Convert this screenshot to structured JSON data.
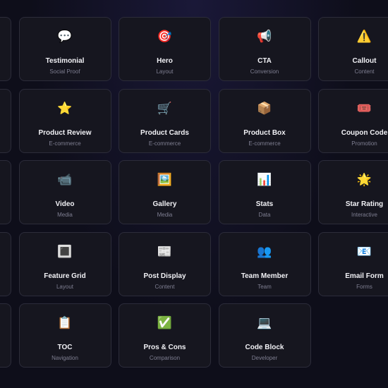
{
  "blocks": [
    {
      "icon": "",
      "name": "",
      "category": ""
    },
    {
      "icon": "💬",
      "icon_name": "speech-bubble-icon",
      "name": "Testimonial",
      "category": "Social Proof"
    },
    {
      "icon": "🎯",
      "icon_name": "target-icon",
      "name": "Hero",
      "category": "Layout"
    },
    {
      "icon": "📢",
      "icon_name": "megaphone-icon",
      "name": "CTA",
      "category": "Conversion"
    },
    {
      "icon": "⚠️",
      "icon_name": "warning-icon",
      "name": "Callout",
      "category": "Content"
    },
    {
      "icon": "",
      "name": "",
      "category": ""
    },
    {
      "icon": "⭐",
      "icon_name": "star-icon",
      "name": "Product Review",
      "category": "E-commerce"
    },
    {
      "icon": "🛒",
      "icon_name": "cart-icon",
      "name": "Product Cards",
      "category": "E-commerce"
    },
    {
      "icon": "📦",
      "icon_name": "package-icon",
      "name": "Product Box",
      "category": "E-commerce"
    },
    {
      "icon": "🎟️",
      "icon_name": "ticket-icon",
      "name": "Coupon Code",
      "category": "Promotion"
    },
    {
      "icon": "",
      "name": "",
      "category": ""
    },
    {
      "icon": "📹",
      "icon_name": "video-camera-icon",
      "name": "Video",
      "category": "Media"
    },
    {
      "icon": "🖼️",
      "icon_name": "framed-picture-icon",
      "name": "Gallery",
      "category": "Media"
    },
    {
      "icon": "📊",
      "icon_name": "bar-chart-icon",
      "name": "Stats",
      "category": "Data"
    },
    {
      "icon": "🌟",
      "icon_name": "glowing-star-icon",
      "name": "Star Rating",
      "category": "Interactive"
    },
    {
      "icon": "",
      "name": "",
      "category": ""
    },
    {
      "icon": "🔳",
      "icon_name": "square-button-icon",
      "name": "Feature Grid",
      "category": "Layout"
    },
    {
      "icon": "📰",
      "icon_name": "newspaper-icon",
      "name": "Post Display",
      "category": "Content"
    },
    {
      "icon": "👥",
      "icon_name": "people-icon",
      "name": "Team Member",
      "category": "Team"
    },
    {
      "icon": "📧",
      "icon_name": "email-icon",
      "name": "Email Form",
      "category": "Forms"
    },
    {
      "icon": "",
      "name": "",
      "category": ""
    },
    {
      "icon": "📋",
      "icon_name": "clipboard-icon",
      "name": "TOC",
      "category": "Navigation"
    },
    {
      "icon": "✅",
      "icon_name": "check-mark-icon",
      "name": "Pros & Cons",
      "category": "Comparison"
    },
    {
      "icon": "💻",
      "icon_name": "laptop-icon",
      "name": "Code Block",
      "category": "Developer"
    }
  ]
}
